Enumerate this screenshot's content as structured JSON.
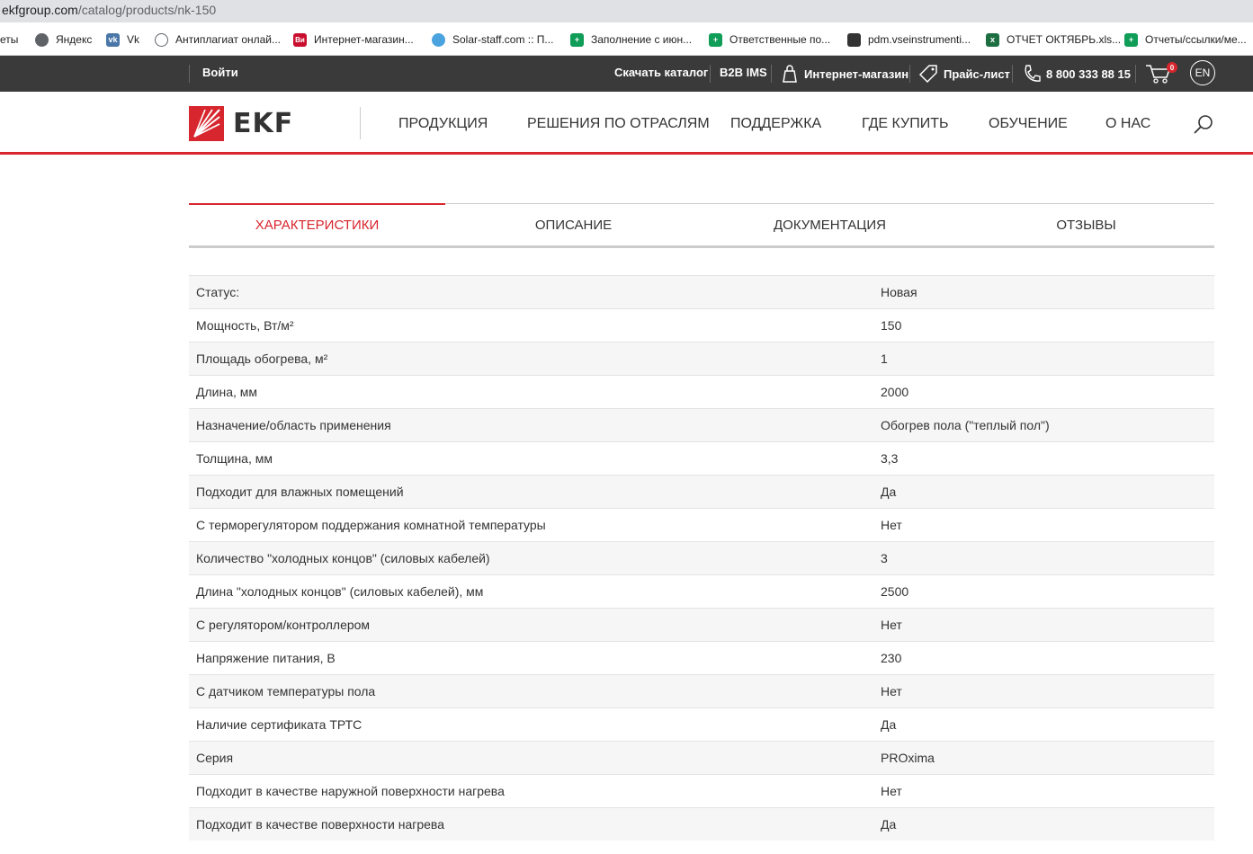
{
  "browser": {
    "url_host": "ekfgroup.com",
    "url_path": "/catalog/products/nk-150",
    "bookmarks": [
      {
        "label": "еты",
        "icon": "none"
      },
      {
        "label": "Яндекс",
        "icon": "globe-icon"
      },
      {
        "label": "Vk",
        "icon": "vk-icon"
      },
      {
        "label": "Антиплагиат онлай...",
        "icon": "eye-icon"
      },
      {
        "label": "Интернет-магазин...",
        "icon": "vi-icon"
      },
      {
        "label": "Solar-staff.com :: П...",
        "icon": "solar-icon"
      },
      {
        "label": "Заполнение с июн...",
        "icon": "sheet-icon"
      },
      {
        "label": "Ответственные по...",
        "icon": "sheet-icon"
      },
      {
        "label": "pdm.vseinstrumenti...",
        "icon": "pdm-icon"
      },
      {
        "label": "ОТЧЕТ ОКТЯБРЬ.xls...",
        "icon": "excel-icon"
      },
      {
        "label": "Отчеты/ссылки/ме...",
        "icon": "sheet-icon"
      }
    ]
  },
  "topbar": {
    "login": "Войти",
    "catalog": "Скачать каталог",
    "b2b": "B2B IMS",
    "shop": "Интернет-магазин",
    "price": "Прайс-лист",
    "phone": "8 800 333 88 15",
    "cart_count": "0",
    "lang": "EN"
  },
  "nav": {
    "logo": "EKF",
    "items": [
      "ПРОДУКЦИЯ",
      "РЕШЕНИЯ ПО ОТРАСЛЯМ",
      "ПОДДЕРЖКА",
      "ГДЕ КУПИТЬ",
      "ОБУЧЕНИЕ",
      "О НАС"
    ]
  },
  "tabs": [
    "ХАРАКТЕРИСТИКИ",
    "ОПИСАНИЕ",
    "ДОКУМЕНТАЦИЯ",
    "ОТЗЫВЫ"
  ],
  "colors": {
    "accent": "#d7262d",
    "topbar": "#3a3a3a"
  },
  "specs": [
    {
      "k": "Статус:",
      "v": "Новая"
    },
    {
      "k": "Мощность, Вт/м²",
      "v": "150"
    },
    {
      "k": "Площадь обогрева, м²",
      "v": "1"
    },
    {
      "k": "Длина, мм",
      "v": "2000"
    },
    {
      "k": "Назначение/область применения",
      "v": "Обогрев пола (\"теплый пол\")"
    },
    {
      "k": "Толщина, мм",
      "v": "3,3"
    },
    {
      "k": "Подходит для влажных помещений",
      "v": "Да"
    },
    {
      "k": "С терморегулятором поддержания комнатной температуры",
      "v": "Нет"
    },
    {
      "k": "Количество \"холодных концов\" (силовых кабелей)",
      "v": "3"
    },
    {
      "k": "Длина \"холодных концов\" (силовых кабелей), мм",
      "v": "2500"
    },
    {
      "k": "С регулятором/контроллером",
      "v": "Нет"
    },
    {
      "k": "Напряжение питания, В",
      "v": "230"
    },
    {
      "k": "С датчиком температуры пола",
      "v": "Нет"
    },
    {
      "k": "Наличие сертификата ТРТС",
      "v": "Да"
    },
    {
      "k": "Серия",
      "v": "PROxima"
    },
    {
      "k": "Подходит в качестве наружной поверхности нагрева",
      "v": "Нет"
    },
    {
      "k": "Подходит в качестве поверхности нагрева",
      "v": "Да"
    }
  ]
}
